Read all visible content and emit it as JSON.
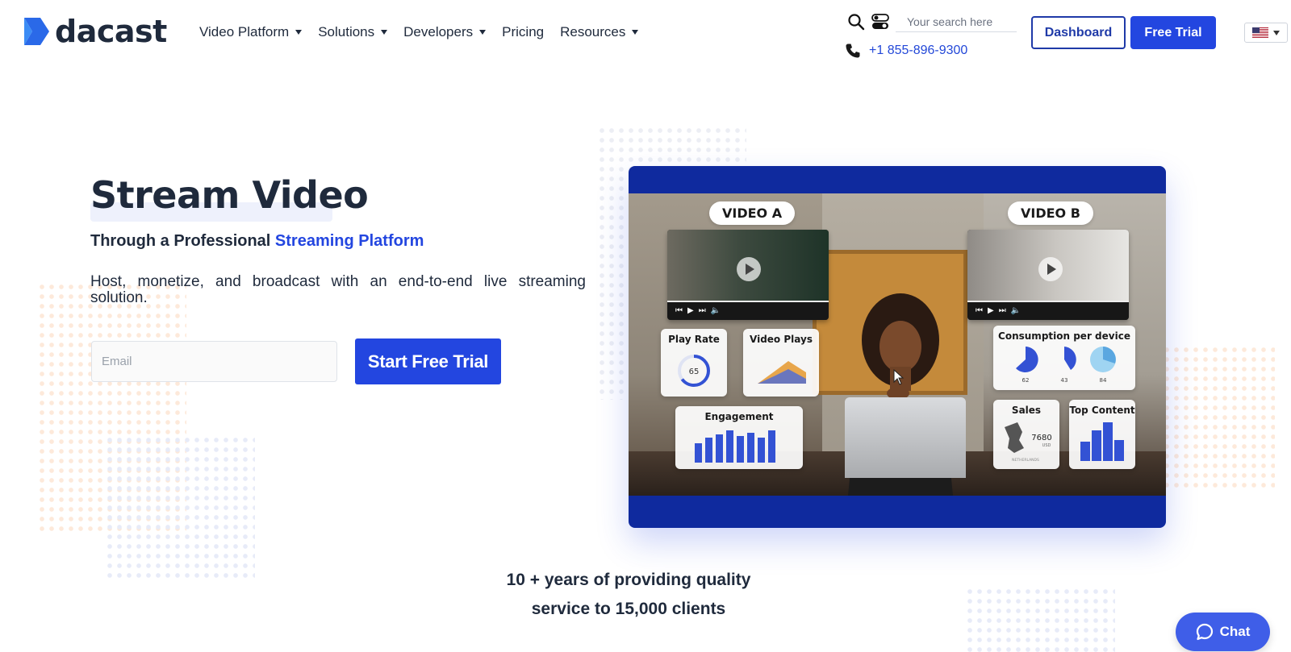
{
  "brand": {
    "name": "dacast"
  },
  "nav": {
    "items": [
      {
        "label": "Video Platform",
        "has_dropdown": true
      },
      {
        "label": "Solutions",
        "has_dropdown": true
      },
      {
        "label": "Developers",
        "has_dropdown": true
      },
      {
        "label": "Pricing",
        "has_dropdown": false
      },
      {
        "label": "Resources",
        "has_dropdown": true
      }
    ]
  },
  "search": {
    "placeholder": "Your search here"
  },
  "contact": {
    "phone": "+1 855-896-9300"
  },
  "header_buttons": {
    "dashboard": "Dashboard",
    "free_trial": "Free Trial"
  },
  "language": {
    "flag": "us-flag"
  },
  "hero": {
    "title": "Stream Video",
    "subtitle_prefix": "Through a Professional",
    "subtitle_accent": "Streaming Platform",
    "description": "Host, monetize, and broadcast with an end-to-end live streaming solution.",
    "email_placeholder": "Email",
    "cta": "Start Free Trial"
  },
  "video_panel": {
    "label_a": "VIDEO A",
    "label_b": "VIDEO B",
    "widgets": {
      "play_rate": {
        "title": "Play Rate",
        "value": "65",
        "unit": "%"
      },
      "video_plays": {
        "title": "Video Plays"
      },
      "engagement": {
        "title": "Engagement",
        "bars": [
          0.55,
          0.7,
          0.8,
          0.9,
          0.75,
          0.85,
          0.7,
          0.9
        ]
      },
      "consumption": {
        "title": "Consumption per device",
        "values": [
          "62",
          "43",
          "84"
        ],
        "unit": "%"
      },
      "sales": {
        "title": "Sales",
        "value": "7680",
        "currency": "USD",
        "region": "NETHERLANDS"
      },
      "top_content": {
        "title": "Top Content",
        "bars": [
          0.5,
          0.8,
          1.0,
          0.55
        ]
      }
    }
  },
  "stats": {
    "line1": "10 + years of providing quality",
    "line2": "service to 15,000 clients"
  },
  "chat": {
    "label": "Chat"
  },
  "colors": {
    "accent": "#2346e0",
    "text": "#1f2a3c",
    "panel": "#0f2a9e"
  }
}
